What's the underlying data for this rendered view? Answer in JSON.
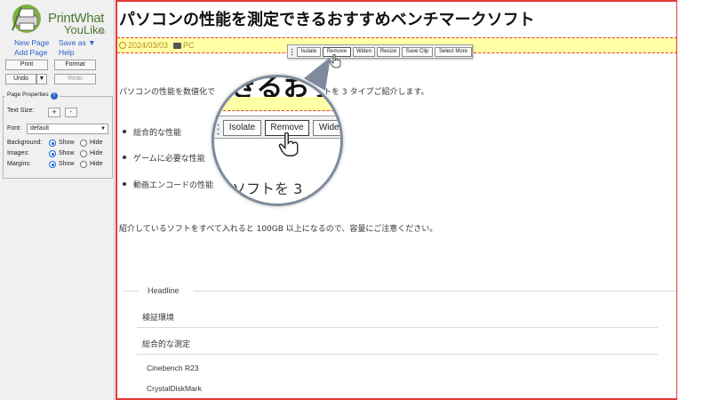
{
  "sidebar": {
    "logo": {
      "line1": "PrintWhat",
      "line2": "YouLike",
      "suffix": ".com"
    },
    "links": {
      "new_page": "New Page",
      "save_as": "Save as ▼",
      "add_page": "Add Page",
      "help": "Help"
    },
    "buttons": {
      "print": "Print",
      "format": "Format",
      "undo": "Undo",
      "undo_menu": "▼",
      "redo": "Redo"
    },
    "page_properties": {
      "legend": "Page Properties",
      "help": "?",
      "text_size_label": "Text Size:",
      "increase": "+",
      "decrease": "-",
      "font_label": "Font:",
      "font_value": "default",
      "background_label": "Background:",
      "images_label": "Images:",
      "margins_label": "Margins:",
      "show_label": "Show",
      "hide_label": "Hide",
      "background": "show",
      "images": "show",
      "margins": "show"
    }
  },
  "article": {
    "title": "パソコンの性能を測定できるおすすめベンチマークソフト",
    "date": "2024/03/03",
    "category": "PC",
    "intro": "パソコンの性能を数値化でき…ソフトを 3 タイプご紹介します。",
    "intro_left": "パソコンの性能を数値化で",
    "intro_right": "トを 3 タイプご紹介します。",
    "bullets": [
      "総合的な性能",
      "ゲームに必要な性能",
      "動画エンコードの性能"
    ],
    "note": "紹介しているソフトをすべて入れると 100GB 以上になるので、容量にご注意ください。"
  },
  "toc": {
    "heading": "Headline",
    "items": [
      "検証環境",
      "総合的な測定"
    ],
    "subitems": [
      "Cinebench R23",
      "CrystalDiskMark"
    ]
  },
  "toolbar": {
    "buttons": [
      "Isolate",
      "Remove",
      "Widen",
      "Resize",
      "Save Clip",
      "Select More"
    ],
    "active": "Remove"
  },
  "magnifier": {
    "title_fragment": "きるおす",
    "text_fragment": "ソフトを 3 ",
    "buttons": [
      "Isolate",
      "Remove",
      "Widen"
    ]
  },
  "colors": {
    "selection_border": "#e53935",
    "highlight": "#ffffa6",
    "link": "#2a62c9",
    "logo": "#4e7a2e"
  }
}
